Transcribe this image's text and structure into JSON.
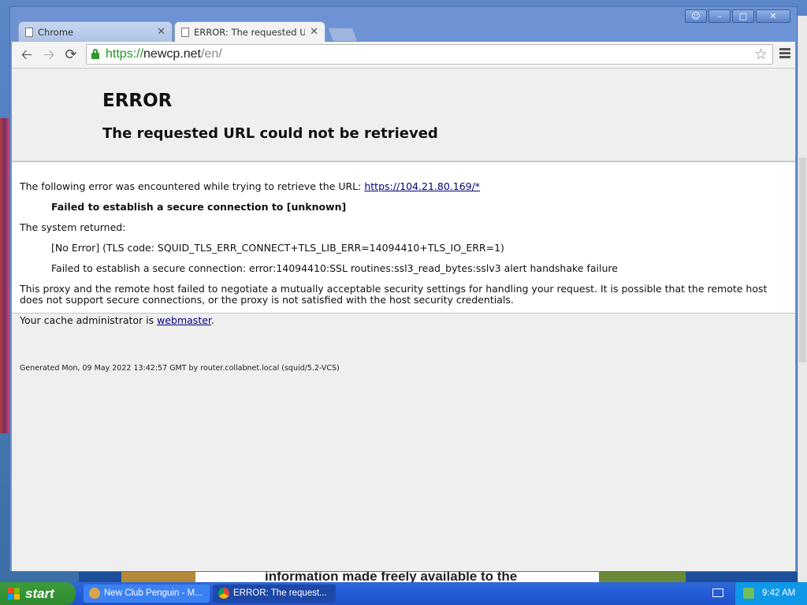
{
  "browser": {
    "tabs": [
      {
        "label": "Chrome",
        "active": false
      },
      {
        "label": "ERROR: The requested URL",
        "active": true
      }
    ],
    "url": {
      "scheme": "https://",
      "host": "newcp.net",
      "path": "/en/"
    }
  },
  "page": {
    "title": "ERROR",
    "subtitle": "The requested URL could not be retrieved",
    "intro": "The following error was encountered while trying to retrieve the URL: ",
    "intro_link": "https://104.21.80.169/*",
    "failure": "Failed to establish a secure connection to [unknown]",
    "system_returned": "The system returned:",
    "tls_code": "[No Error] (TLS code: SQUID_TLS_ERR_CONNECT+TLS_LIB_ERR=14094410+TLS_IO_ERR=1)",
    "tls_detail": "Failed to establish a secure connection: error:14094410:SSL routines:ssl3_read_bytes:sslv3 alert handshake failure",
    "explanation_1": "This proxy and the remote host failed to negotiate a mutually acceptable security settings for handling your request. It is possible that the remote host",
    "explanation_2": "does not support secure connections, or the proxy is not satisfied with the host security credentials.",
    "admin_prefix": "Your cache administrator is ",
    "admin_link": "webmaster",
    "admin_suffix": ".",
    "footer": "Generated Mon, 09 May 2022 13:42:57 GMT by router.collabnet.local (squid/5.2-VCS)"
  },
  "background": {
    "partial_text": "information made freely available to the"
  },
  "taskbar": {
    "start_label": "start",
    "tasks": [
      {
        "label": "New Club Penguin - M..."
      },
      {
        "label": "ERROR: The request..."
      }
    ],
    "clock": "9:42 AM"
  },
  "colors": {
    "secure_green": "#1e9a1e",
    "link": "#00007a",
    "taskbar_blue": "#245edb",
    "start_green": "#3c9a3c"
  }
}
